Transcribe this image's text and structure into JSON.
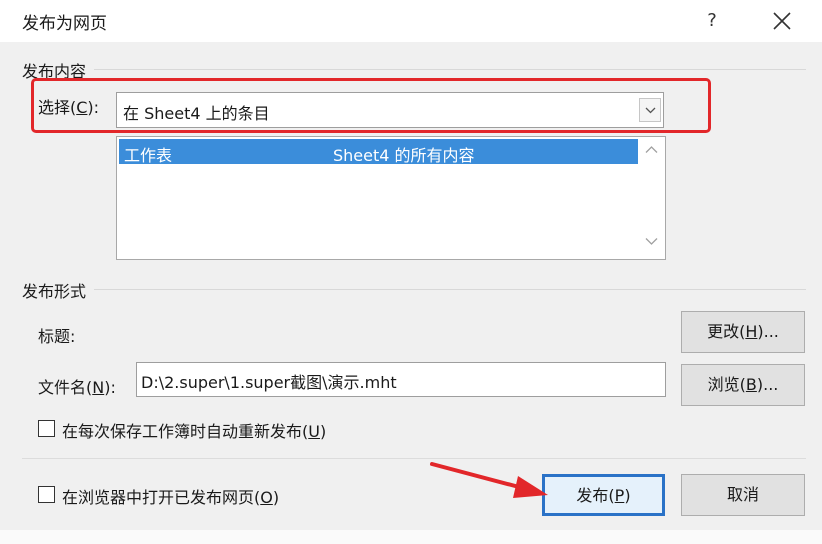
{
  "dialog": {
    "title": "发布为网页",
    "help": "?"
  },
  "content_section": {
    "heading": "发布内容",
    "choose_label": "选择(",
    "choose_key": "C",
    "choose_end": "):",
    "choose_value": "在 Sheet4 上的条目",
    "list_items": [
      {
        "col1": "工作表",
        "col2": "Sheet4 的所有内容"
      }
    ]
  },
  "format_section": {
    "heading": "发布形式",
    "title_label": "标题:",
    "change_btn": {
      "pre": "更改(",
      "key": "H",
      "post": ")..."
    },
    "filename_label": {
      "pre": "文件名(",
      "key": "N",
      "post": "):"
    },
    "filename_value": "D:\\2.super\\1.super截图\\演示.mht",
    "browse_btn": {
      "pre": "浏览(",
      "key": "B",
      "post": ")..."
    },
    "autorepublish": {
      "pre": "在每次保存工作簿时自动重新发布(",
      "key": "U",
      "post": ")"
    }
  },
  "footer": {
    "open_in_browser": {
      "pre": "在浏览器中打开已发布网页(",
      "key": "O",
      "post": ")"
    },
    "publish_btn": {
      "pre": "发布(",
      "key": "P",
      "post": ")"
    },
    "cancel_btn": "取消"
  },
  "colors": {
    "selection": "#3b8dda",
    "annotation_red": "#e2272a",
    "primary_border": "#2a72c7"
  },
  "icons": [
    "close-icon",
    "chevron-down-icon",
    "scroll-up-icon",
    "scroll-down-icon",
    "annotation-arrow"
  ]
}
